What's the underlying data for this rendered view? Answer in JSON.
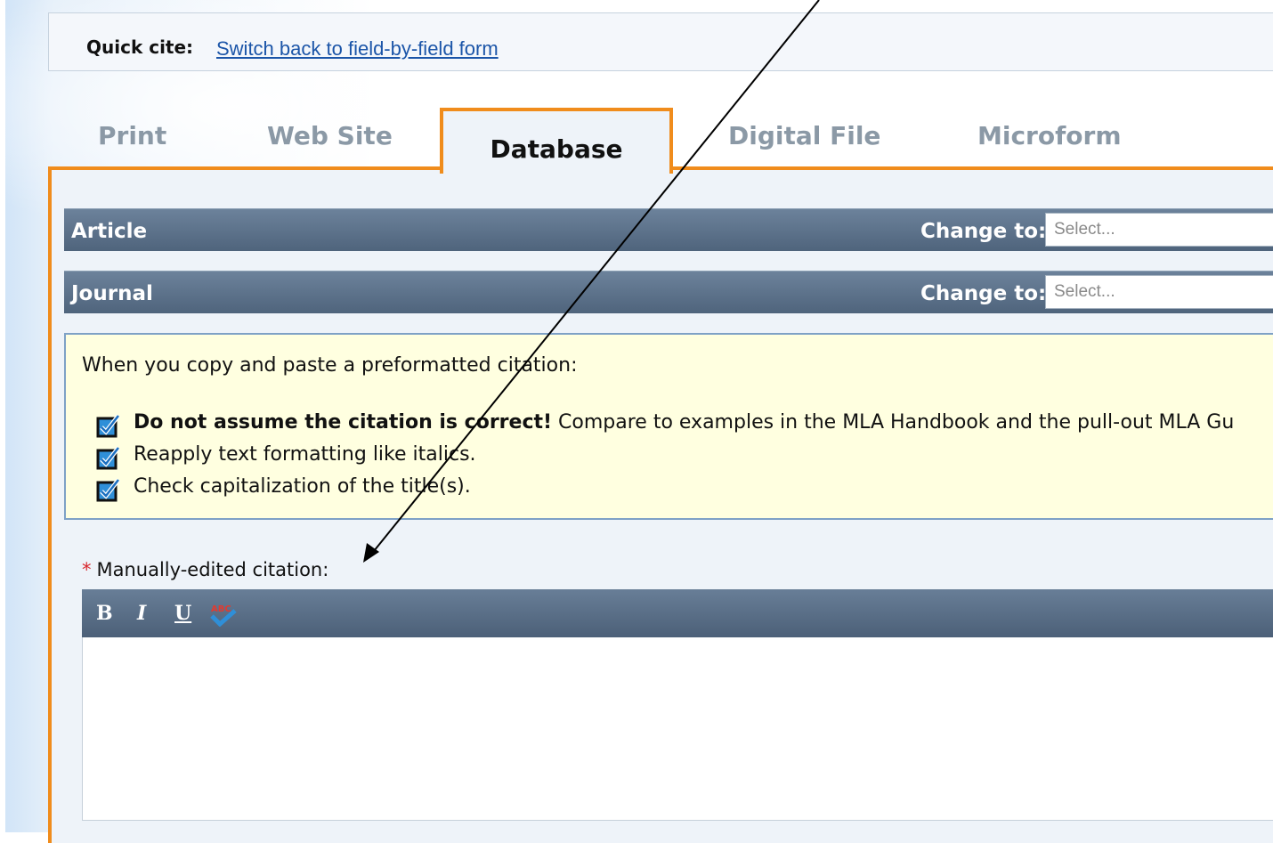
{
  "quick_cite": {
    "label": "Quick cite:",
    "link": "Switch back to field-by-field form"
  },
  "tabs": [
    {
      "label": "Print"
    },
    {
      "label": "Web Site"
    },
    {
      "label": "Database",
      "active": true
    },
    {
      "label": "Digital File"
    },
    {
      "label": "Microform"
    }
  ],
  "type_bars": [
    {
      "label": "Article",
      "change_label": "Change to:",
      "select_placeholder": "Select..."
    },
    {
      "label": "Journal",
      "change_label": "Change to:",
      "select_placeholder": "Select..."
    }
  ],
  "info": {
    "intro": "When you copy and paste a preformatted citation:",
    "items": [
      {
        "bold": "Do not assume the citation is correct!",
        "text": " Compare to examples in the MLA Handbook and the pull-out MLA Gu"
      },
      {
        "bold": "",
        "text": "Reapply text formatting like italics."
      },
      {
        "bold": "",
        "text": "Check capitalization of the title(s)."
      }
    ]
  },
  "manual": {
    "required_mark": "*",
    "label": "Manually-edited citation:"
  },
  "editor": {
    "bold": "B",
    "italic": "I",
    "underline": "U",
    "spellcheck_icon_text": "ABC",
    "value": ""
  },
  "colors": {
    "accent_orange": "#f08c1c",
    "bar_blue": "#566b83",
    "info_bg": "#ffffe0",
    "link_blue": "#1b55a8"
  }
}
